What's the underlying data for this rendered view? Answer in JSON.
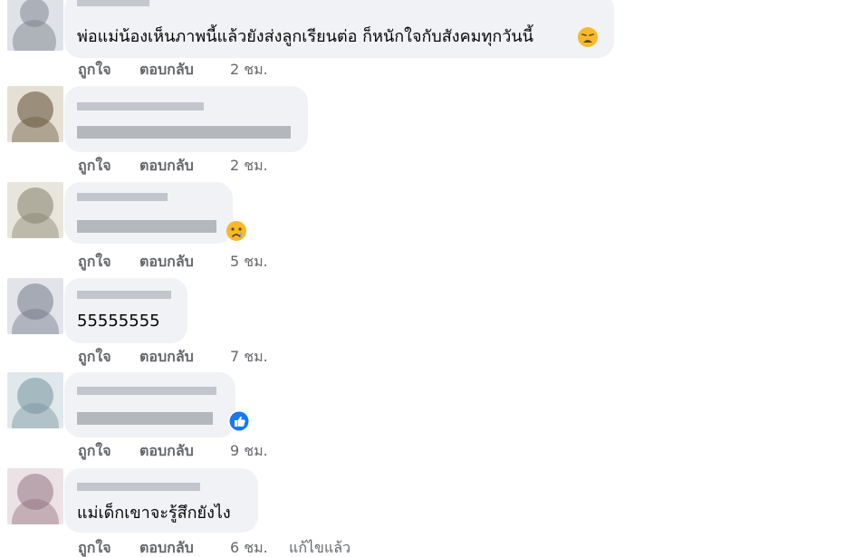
{
  "comments": [
    {
      "text": "พ่อแม่น้องเห็นภาพนี้แล้วยังส่งลูกเรียนต่อ ก็หนักใจกับสังคมทุกวันนี้",
      "emoji": "weary-face",
      "actions": {
        "like": "ถูกใจ",
        "reply": "ตอบกลับ"
      },
      "time": "2 ชม."
    },
    {
      "text": "",
      "actions": {
        "like": "ถูกใจ",
        "reply": "ตอบกลับ"
      },
      "time": "2 ชม."
    },
    {
      "text": "",
      "emoji": "sad-tear-face",
      "actions": {
        "like": "ถูกใจ",
        "reply": "ตอบกลับ"
      },
      "time": "5 ชม."
    },
    {
      "text": "55555555",
      "actions": {
        "like": "ถูกใจ",
        "reply": "ตอบกลับ"
      },
      "time": "7 ชม."
    },
    {
      "text": "",
      "reaction": "like-reaction",
      "actions": {
        "like": "ถูกใจ",
        "reply": "ตอบกลับ"
      },
      "time": "9 ชม."
    },
    {
      "text": "แม่เด็กเขาจะรู้สึกยังไง",
      "actions": {
        "like": "ถูกใจ",
        "reply": "ตอบกลับ"
      },
      "time": "6 ชม.",
      "edited": "แก้ไขแล้ว"
    }
  ],
  "colors": {
    "bubble": "#f0f2f5",
    "action_text": "#65676b",
    "body_text": "#050505",
    "like_blue": "#1877f2"
  }
}
